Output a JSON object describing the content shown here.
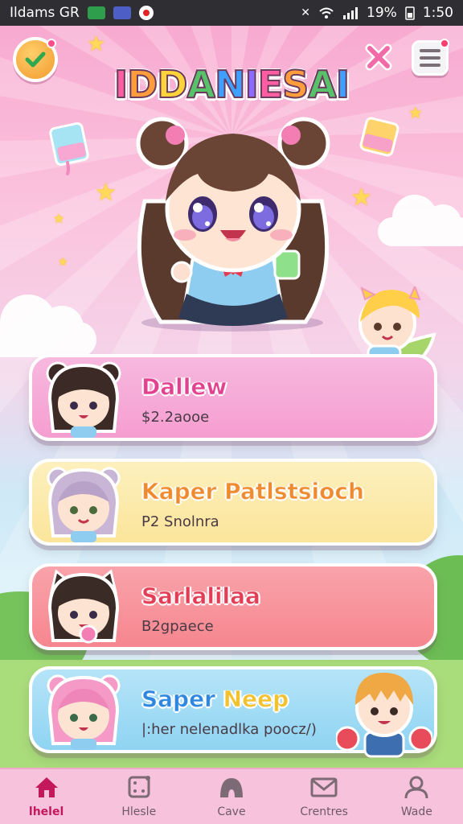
{
  "status_bar": {
    "left_text": "Ildams GR",
    "battery": "19%",
    "time": "1:50",
    "icons": [
      "mail-icon",
      "app-icon",
      "record-icon",
      "mute-icon",
      "wifi-icon",
      "signal-icon",
      "battery-icon"
    ]
  },
  "header": {
    "logo_text": "IDDANIESAI",
    "logo_colors": [
      "#ff5fa2",
      "#ff9d3c",
      "#ffd43b",
      "#58c26a",
      "#3fa0ff",
      "#8b6bff",
      "#ff5fa2",
      "#ff9d3c",
      "#58c26a",
      "#3fa0ff"
    ],
    "check_icon": "check-badge-icon",
    "close_icon": "close-icon",
    "menu_icon": "menu-icon"
  },
  "cards": [
    {
      "title": "Dallew",
      "subtitle": "$2.2aooe",
      "bg": "#f59ed0",
      "bg2": "#f7b8de",
      "title_color": "#e2418f"
    },
    {
      "title": "Kaper Patlstsioch",
      "subtitle": "P2 Snolnra",
      "bg": "#fbe59a",
      "bg2": "#fdf0be",
      "title_color": "#f08a2e"
    },
    {
      "title": "Sarlalilaa",
      "subtitle": "B2gpaece",
      "bg": "#f6868f",
      "bg2": "#f9a3aa",
      "title_color": "#e23d55"
    },
    {
      "title": "Saper Neep",
      "subtitle": "|:her nelenadlka poocz/)",
      "bg": "#8fd4f2",
      "bg2": "#b5e4f8",
      "title_color": "#2d87e0",
      "title_color2": "#f2c12e"
    }
  ],
  "bottom_nav": [
    {
      "label": "lhelel",
      "icon": "home-icon",
      "active": true
    },
    {
      "label": "Hlesle",
      "icon": "dice-icon",
      "active": false
    },
    {
      "label": "Cave",
      "icon": "cave-icon",
      "active": false
    },
    {
      "label": "Crentres",
      "icon": "mail-icon",
      "active": false
    },
    {
      "label": "Wade",
      "icon": "user-icon",
      "active": false
    }
  ]
}
